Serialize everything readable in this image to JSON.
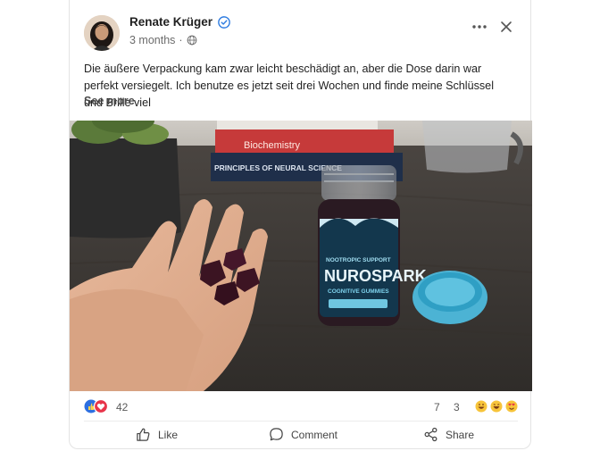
{
  "post": {
    "author": "Renate Krüger",
    "time": "3 months",
    "separator": "·",
    "text": "Die äußere Verpackung kam zwar leicht beschädigt an, aber die Dose darin war perfekt versiegelt. Ich benutze es jetzt seit drei Wochen und finde meine Schlüssel und Brille viel",
    "see_more": "See more"
  },
  "image": {
    "books": [
      "Biochemistry",
      "PRINCIPLES OF NEURAL SCIENCE"
    ],
    "jar_brand": "NUROSPARK",
    "jar_sub": "COGNITIVE GUMMIES",
    "jar_top": "NOOTROPIC SUPPORT"
  },
  "stats": {
    "reactions": "42",
    "comments": "7",
    "shares": "3"
  },
  "actions": {
    "like": "Like",
    "comment": "Comment",
    "share": "Share"
  },
  "colors": {
    "verified": "#2d7be0",
    "like_blue": "#2d6fe0",
    "love_red": "#e8344a"
  }
}
